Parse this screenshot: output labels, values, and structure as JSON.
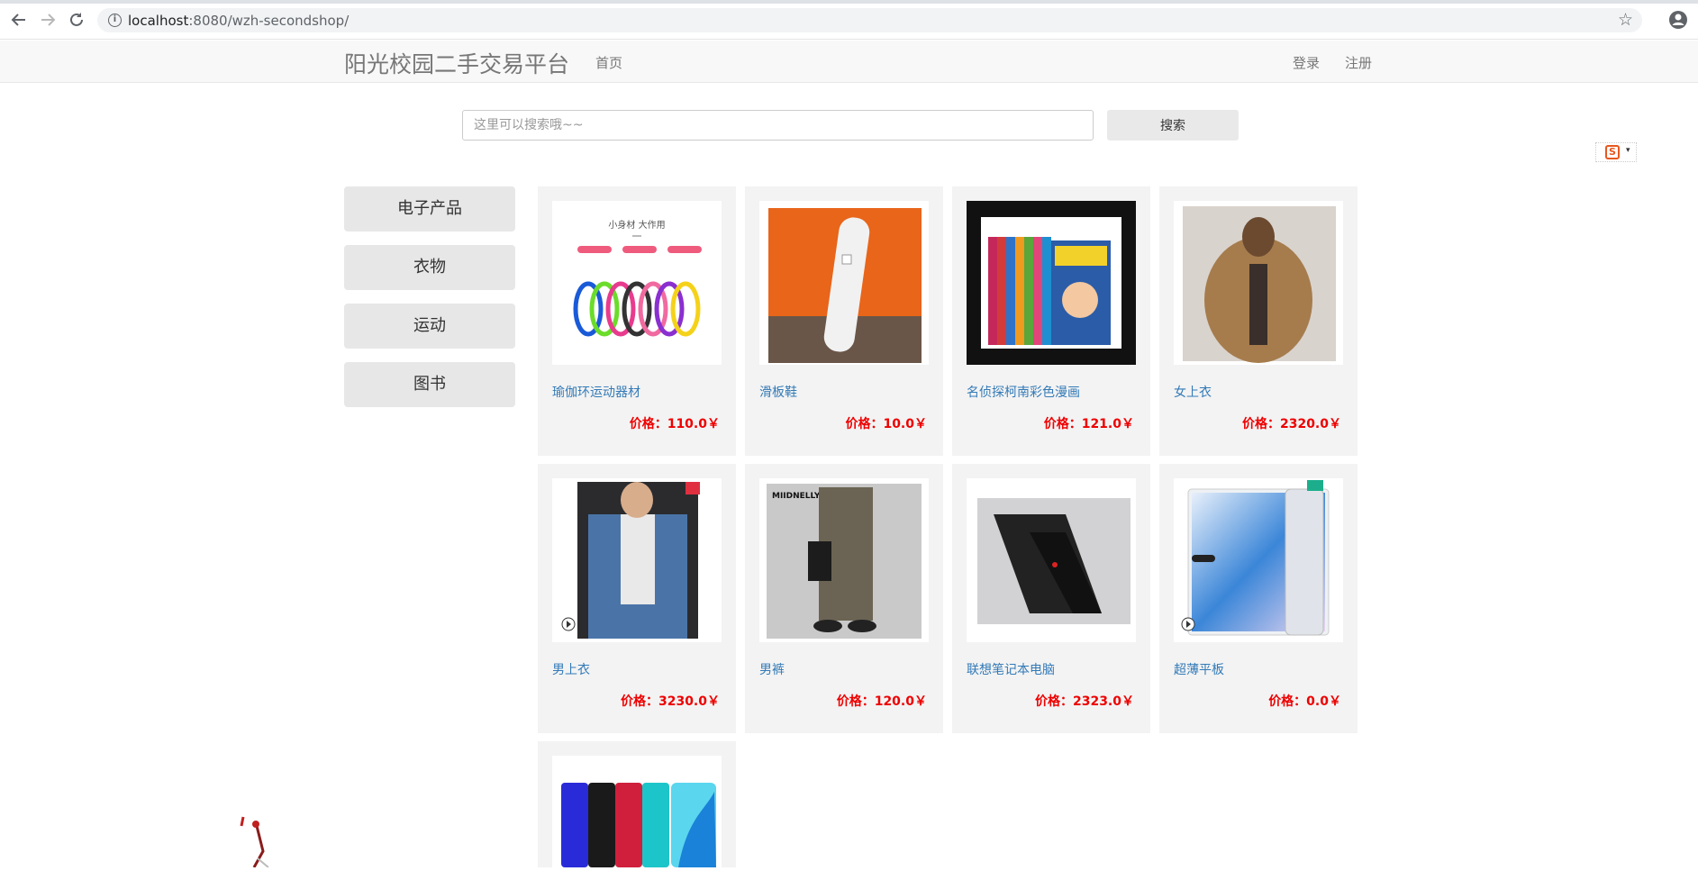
{
  "browser": {
    "url_host": "localhost",
    "url_rest": ":8080/wzh-secondshop/"
  },
  "navbar": {
    "brand": "阳光校园二手交易平台",
    "home": "首页",
    "login": "登录",
    "register": "注册"
  },
  "search": {
    "placeholder": "这里可以搜索哦~~",
    "button": "搜索"
  },
  "categories": [
    "电子产品",
    "衣物",
    "运动",
    "图书"
  ],
  "products": [
    {
      "name": "瑜伽环运动器材",
      "price": "价格：110.0￥",
      "thumb_text": "小身材 大作用"
    },
    {
      "name": "滑板鞋",
      "price": "价格：10.0￥"
    },
    {
      "name": "名侦探柯南彩色漫画",
      "price": "价格：121.0￥"
    },
    {
      "name": "女上衣",
      "price": "价格：2320.0￥"
    },
    {
      "name": "男上衣",
      "price": "价格：3230.0￥"
    },
    {
      "name": "男裤",
      "price": "价格：120.0￥",
      "thumb_text": "MIIDNELLY"
    },
    {
      "name": "联想笔记本电脑",
      "price": "价格：2323.0￥"
    },
    {
      "name": "超薄平板",
      "price": "价格：0.0￥"
    },
    {
      "name": "",
      "price": ""
    }
  ],
  "colors": {
    "link": "#337ab7",
    "price": "#ee0000",
    "card_bg": "#f3f3f3"
  }
}
